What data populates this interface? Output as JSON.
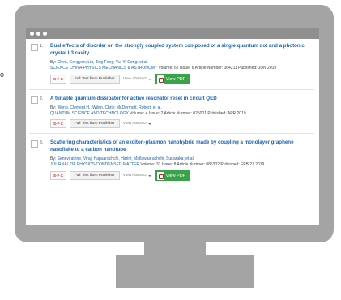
{
  "side_fragment": "o",
  "window": {
    "dots": 3
  },
  "labels": {
    "by_prefix": "By:",
    "volume": "Volume:",
    "issue": "Issue:",
    "article_number": "Article Number:",
    "published": "Published:",
    "full_text": "Full Text from Publisher",
    "view_abstract": "View Abstract",
    "view_pdf": "View PDF",
    "sfx": "S·F·X"
  },
  "records": [
    {
      "number": "1.",
      "title": "Dual effects of disorder on the strongly coupled system composed of a single quantum dot and a photonic crystal L3 cavity",
      "authors": "Chen, Gengyan; Liu, Jing-Feng; Yu, Yi-Cong; et al.",
      "journal": "SCIENCE CHINA-PHYSICS MECHANICS & ASTRONOMY",
      "volume": "62",
      "issue": "6",
      "article_number": "064211",
      "published": "JUN 2019",
      "has_pdf": true
    },
    {
      "number": "2.",
      "title": "A tunable quantum dissipator for active resonator reset in circuit QED",
      "authors": "Wong, Clement H.; Wilen, Chris; McDermott, Robert; et al.",
      "journal": "QUANTUM SCIENCE AND TECHNOLOGY",
      "volume": "4",
      "issue": "2",
      "article_number": "025001",
      "published": "APR 2019",
      "has_pdf": false
    },
    {
      "number": "3.",
      "title": "Scattering characteristics of an exciton-plasmon nanohybrid made by coupling a monolayer graphene nanoflake to a carbon nanotube",
      "authors": "Senevirathne, Viraj; Hapuarachchi, Harini; Mallawaarachchi, Sudaraka; et al.",
      "journal": "JOURNAL OF PHYSICS-CONDENSED MATTER",
      "volume": "31",
      "issue": "8",
      "article_number": "085302",
      "published": "FEB 27 2019",
      "has_pdf": true
    }
  ]
}
